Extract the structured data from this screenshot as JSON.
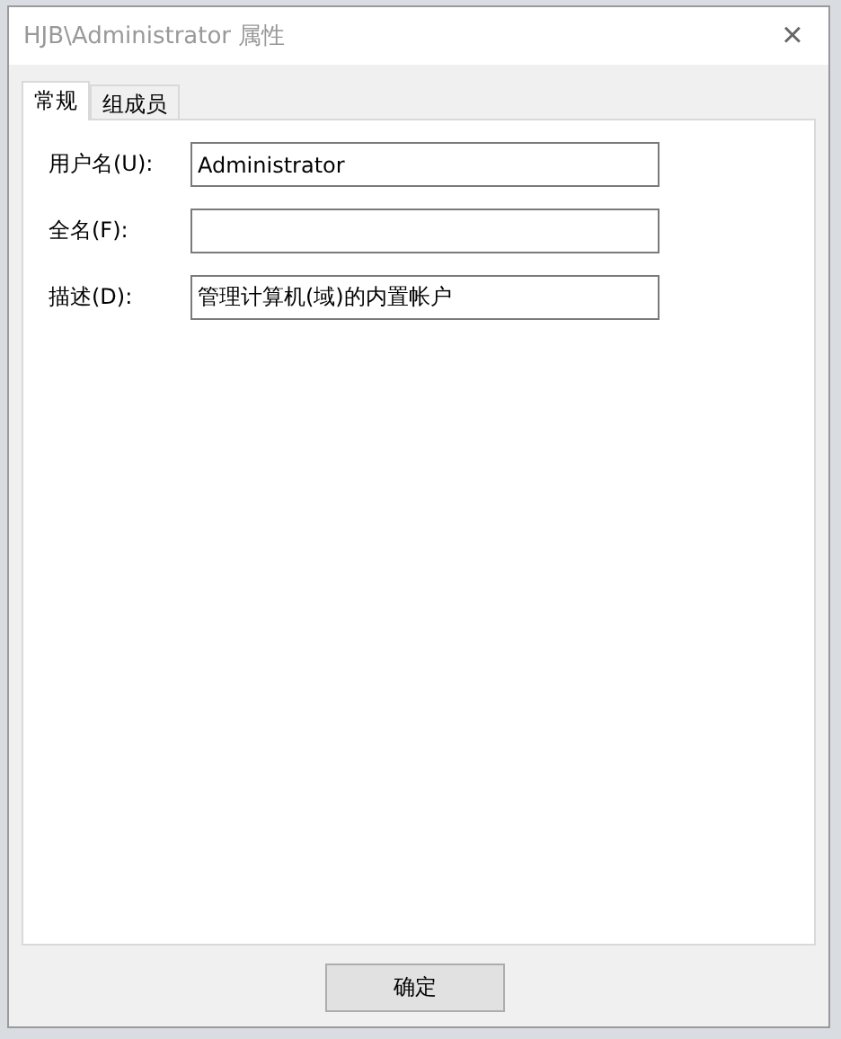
{
  "window": {
    "title": "HJB\\Administrator 属性",
    "close": "×"
  },
  "tabs": [
    {
      "label": "常规",
      "selected": true
    },
    {
      "label": "组成员",
      "selected": false
    }
  ],
  "fields": [
    {
      "label": "用户名(U):",
      "value": "Administrator"
    },
    {
      "label": "全名(F):"
    },
    {
      "label": "描述(D):",
      "value": "管理计算机(域)的内置帐户"
    }
  ],
  "buttons": [
    "确定"
  ]
}
